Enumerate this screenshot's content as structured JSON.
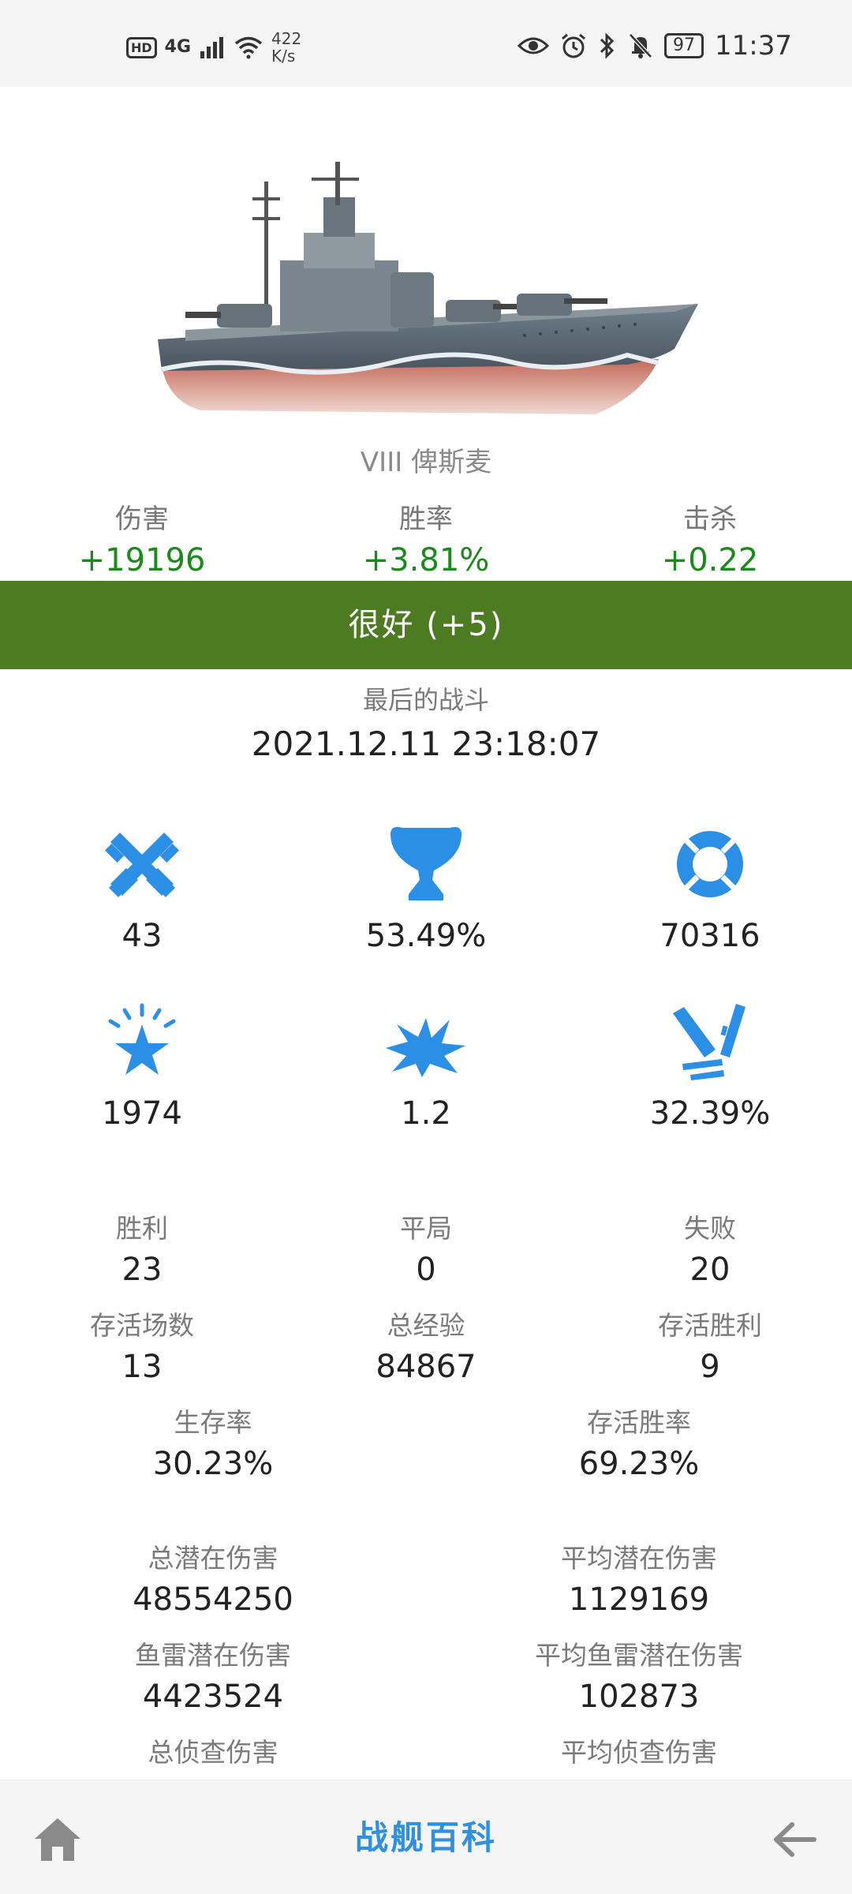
{
  "status_bar": {
    "hd": "HD",
    "network": "4G",
    "speed_value": "422",
    "speed_unit": "K/s",
    "battery": "97",
    "time": "11:37"
  },
  "ship": {
    "name": "VIII 俾斯麦"
  },
  "deltas": [
    {
      "label": "伤害",
      "value": "+19196"
    },
    {
      "label": "胜率",
      "value": "+3.81%"
    },
    {
      "label": "击杀",
      "value": "+0.22"
    }
  ],
  "rating": {
    "text": "很好 (+5)",
    "color": "#4d7b22"
  },
  "last_battle": {
    "label": "最后的战斗",
    "value": "2021.12.11 23:18:07"
  },
  "icon_stats": [
    {
      "icon": "crossed-swords-icon",
      "value": "43"
    },
    {
      "icon": "trophy-icon",
      "value": "53.49%"
    },
    {
      "icon": "lifebuoy-icon",
      "value": "70316"
    },
    {
      "icon": "star-burst-icon",
      "value": "1974"
    },
    {
      "icon": "explosion-icon",
      "value": "1.2"
    },
    {
      "icon": "shells-icon",
      "value": "32.39%"
    }
  ],
  "battle_stats": [
    {
      "label": "胜利",
      "value": "23"
    },
    {
      "label": "平局",
      "value": "0"
    },
    {
      "label": "失败",
      "value": "20"
    },
    {
      "label": "存活场数",
      "value": "13"
    },
    {
      "label": "总经验",
      "value": "84867"
    },
    {
      "label": "存活胜利",
      "value": "9"
    }
  ],
  "survival_stats": [
    {
      "label": "生存率",
      "value": "30.23%"
    },
    {
      "label": "存活胜率",
      "value": "69.23%"
    }
  ],
  "damage_stats": [
    {
      "label": "总潜在伤害",
      "value": "48554250"
    },
    {
      "label": "平均潜在伤害",
      "value": "1129169"
    },
    {
      "label": "鱼雷潜在伤害",
      "value": "4423524"
    },
    {
      "label": "平均鱼雷潜在伤害",
      "value": "102873"
    },
    {
      "label": "总侦查伤害",
      "value": ""
    },
    {
      "label": "平均侦查伤害",
      "value": ""
    }
  ],
  "bottom_bar": {
    "title": "战舰百科",
    "home_icon": "home-icon",
    "back_icon": "arrow-left-icon"
  },
  "colors": {
    "accent_blue": "#2f8fe0",
    "delta_green": "#1a8a1a",
    "rating_green": "#4d7b22"
  }
}
